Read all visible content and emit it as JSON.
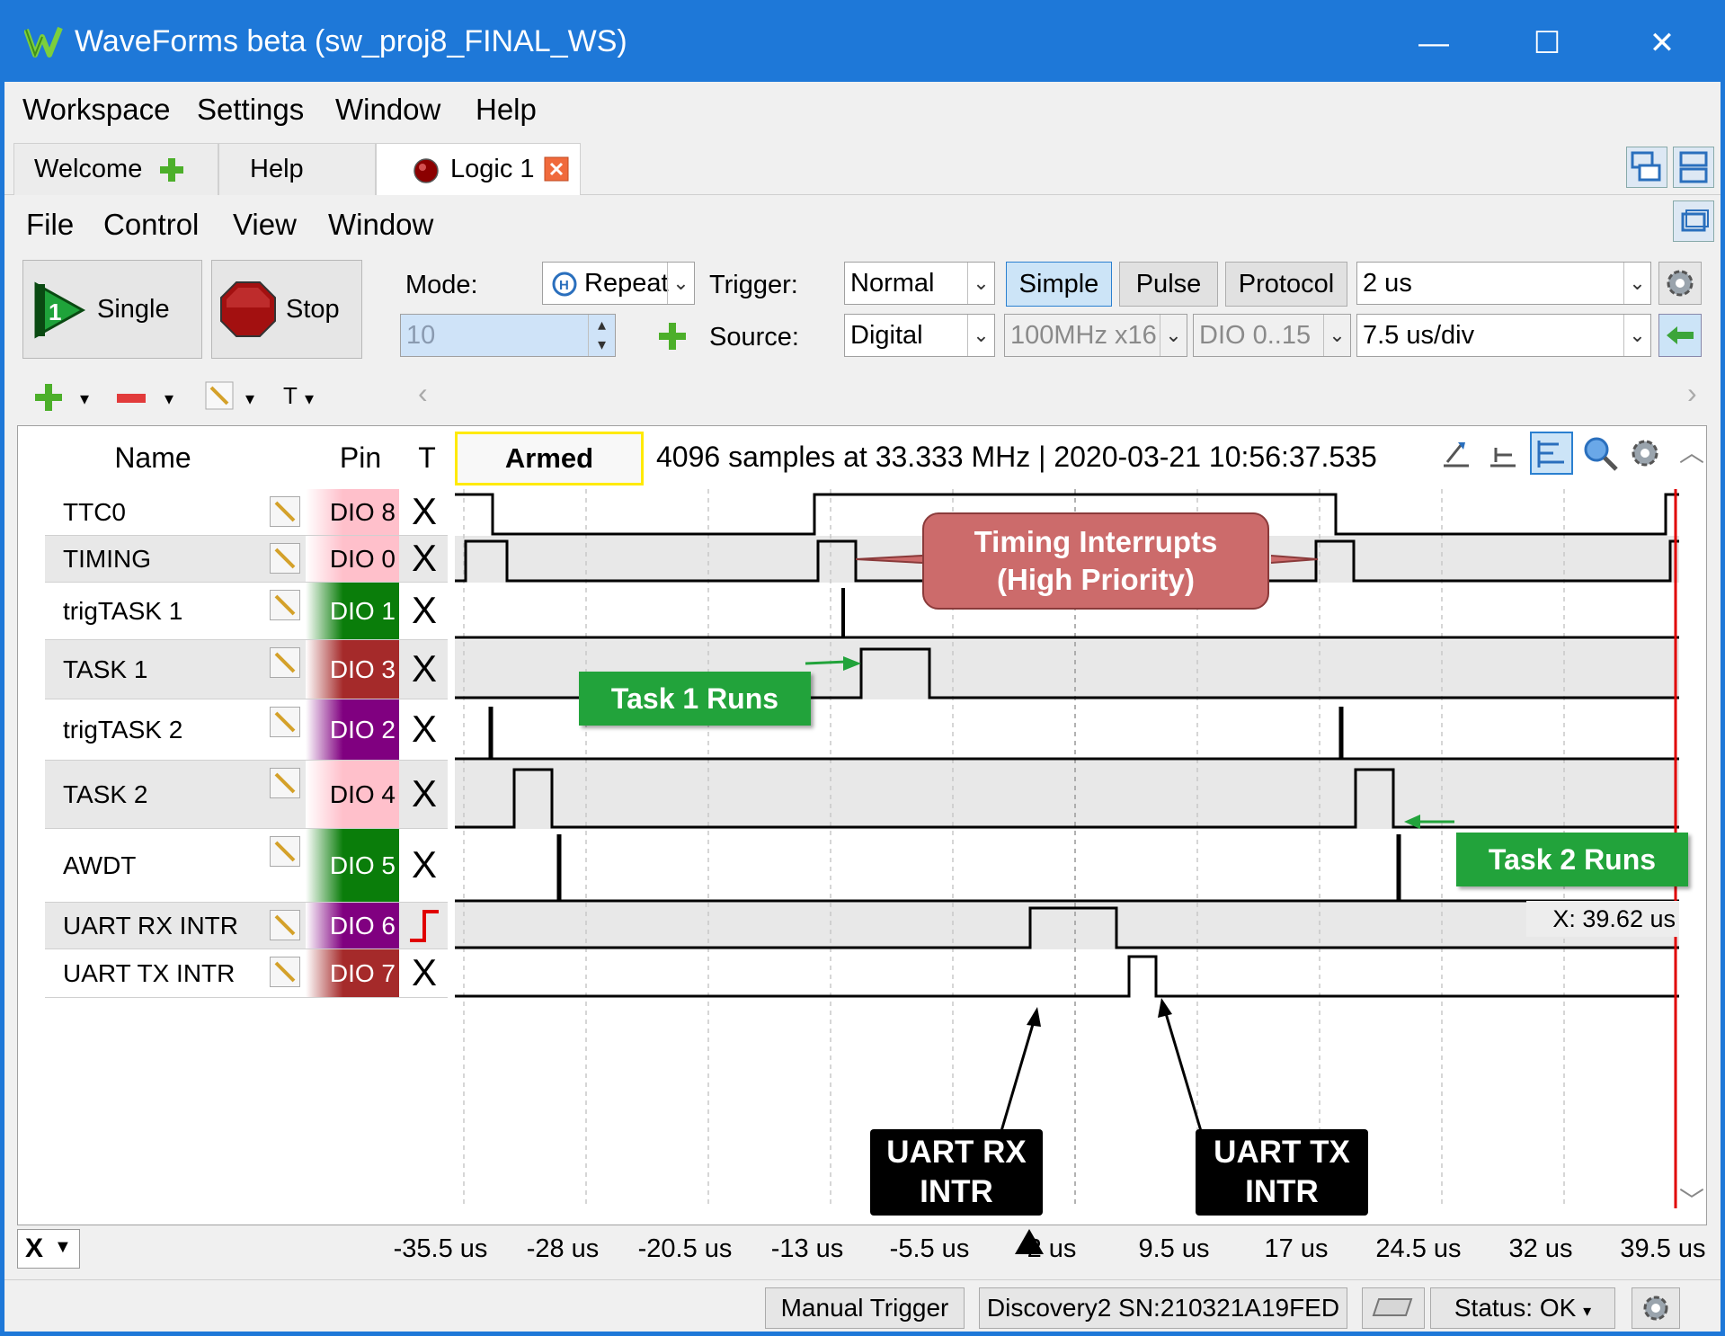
{
  "window": {
    "title": "WaveForms beta (sw_proj8_FINAL_WS)",
    "minimize": "—",
    "maximize": "☐",
    "close": "✕"
  },
  "menubar": [
    "Workspace",
    "Settings",
    "Window",
    "Help"
  ],
  "tabs": {
    "welcome": "Welcome",
    "help": "Help",
    "logic": "Logic 1"
  },
  "submenu": [
    "File",
    "Control",
    "View",
    "Window"
  ],
  "toolbar": {
    "single": "Single",
    "stop": "Stop",
    "mode_label": "Mode:",
    "mode_value": "Repeat",
    "count_value": "10",
    "trigger_label": "Trigger:",
    "trigger_value": "Normal",
    "simple": "Simple",
    "pulse": "Pulse",
    "protocol": "Protocol",
    "position_value": "2 us",
    "source_label": "Source:",
    "source_value": "Digital",
    "rate_value": "100MHz x16",
    "dio_value": "DIO 0..15",
    "base_value": "7.5 us/div"
  },
  "channel_tools": {
    "add": "+",
    "remove": "−",
    "trigger_menu": "T"
  },
  "logic": {
    "headers": {
      "name": "Name",
      "pin": "Pin",
      "trigger": "T"
    },
    "armed": "Armed",
    "info": "4096 samples at 33.333 MHz | 2020-03-21 10:56:37.535",
    "cursor_readout": "X: 39.62 us",
    "channels": [
      {
        "name": "TTC0",
        "pin": "DIO  8",
        "trig": "X",
        "color": "#ffc0cb"
      },
      {
        "name": "TIMING",
        "pin": "DIO  0",
        "trig": "X",
        "color": "#ffc0cb"
      },
      {
        "name": "trigTASK 1",
        "pin": "DIO  1",
        "trig": "X",
        "color": "#0a7d0a"
      },
      {
        "name": "TASK 1",
        "pin": "DIO  3",
        "trig": "X",
        "color": "#a52a2a"
      },
      {
        "name": "trigTASK 2",
        "pin": "DIO  2",
        "trig": "X",
        "color": "#800080"
      },
      {
        "name": "TASK 2",
        "pin": "DIO  4",
        "trig": "X",
        "color": "#ffc0cb"
      },
      {
        "name": "AWDT",
        "pin": "DIO  5",
        "trig": "X",
        "color": "#0a7d0a"
      },
      {
        "name": "UART RX INTR",
        "pin": "DIO  6",
        "trig": "rising",
        "color": "#800080"
      },
      {
        "name": "UART TX INTR",
        "pin": "DIO  7",
        "trig": "X",
        "color": "#a52a2a"
      }
    ]
  },
  "annotations": {
    "timing": "Timing Interrupts\n(High Priority)",
    "task1": "Task 1 Runs",
    "task2": "Task 2 Runs",
    "uart_rx": "UART RX\nINTR",
    "uart_tx": "UART TX\nINTR"
  },
  "xaxis": {
    "unit_label": "X",
    "ticks": [
      "-35.5 us",
      "-28 us",
      "-20.5 us",
      "-13 us",
      "-5.5 us",
      "2 us",
      "9.5 us",
      "17 us",
      "24.5 us",
      "32 us",
      "39.5 us"
    ]
  },
  "statusbar": {
    "manual_trigger": "Manual Trigger",
    "device": "Discovery2 SN:210321A19FED",
    "status": "Status: OK"
  },
  "colors": {
    "title_bar": "#1e78d8",
    "trigger_line": "#e00000",
    "callout_green": "#22a33b",
    "callout_red": "#cc6b6b"
  }
}
